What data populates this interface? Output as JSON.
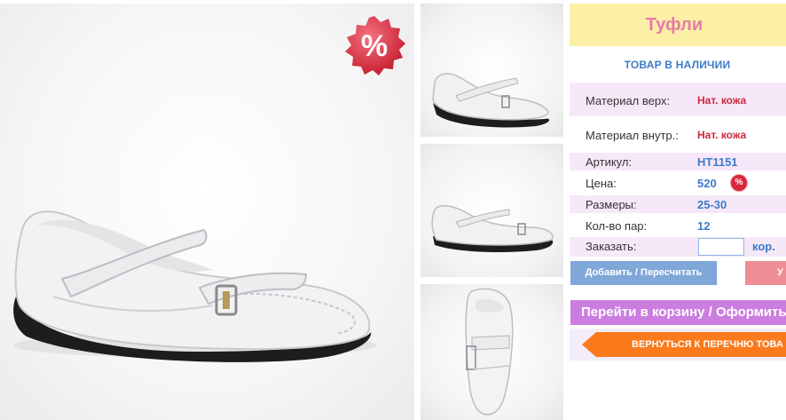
{
  "product": {
    "title": "Туфли",
    "stock_status": "ТОВАР В НАЛИЧИИ",
    "sale_badge": "%"
  },
  "details": {
    "material_top_label": "Материал верх:",
    "material_top_value": "Нат. кожа",
    "material_inner_label": "Материал внутр.:",
    "material_inner_value": "Нат. кожа",
    "article_label": "Артикул:",
    "article_value": "НТ1151",
    "price_label": "Цена:",
    "price_value": "520",
    "price_badge": "%",
    "sizes_label": "Размеры:",
    "sizes_value": "25-30",
    "pairs_label": "Кол-во пар:",
    "pairs_value": "12",
    "order_label": "Заказать:",
    "order_qty": "",
    "order_unit": "кор."
  },
  "buttons": {
    "add_recalc": "Добавить / Пересчитать",
    "delete_partial": "У",
    "go_to_cart": "Перейти в корзину / Оформить",
    "back_to_list": "ВЕРНУТЬСЯ К ПЕРЕЧНЮ ТОВА"
  },
  "icons": {
    "sale": "sale-percent-icon",
    "back_arrow": "arrow-left-icon"
  },
  "colors": {
    "title_bg": "#fbf0a6",
    "title_text": "#e87aa8",
    "stock_text": "#3d7bc7",
    "material_value": "#cc2a3d",
    "row_tint": "#f6e8f8",
    "add_button": "#7fa7d8",
    "delete_button": "#ef8d95",
    "cart_button": "#cc7de0",
    "back_button": "#fb7a1c",
    "sale_badge": "#d8283c"
  }
}
